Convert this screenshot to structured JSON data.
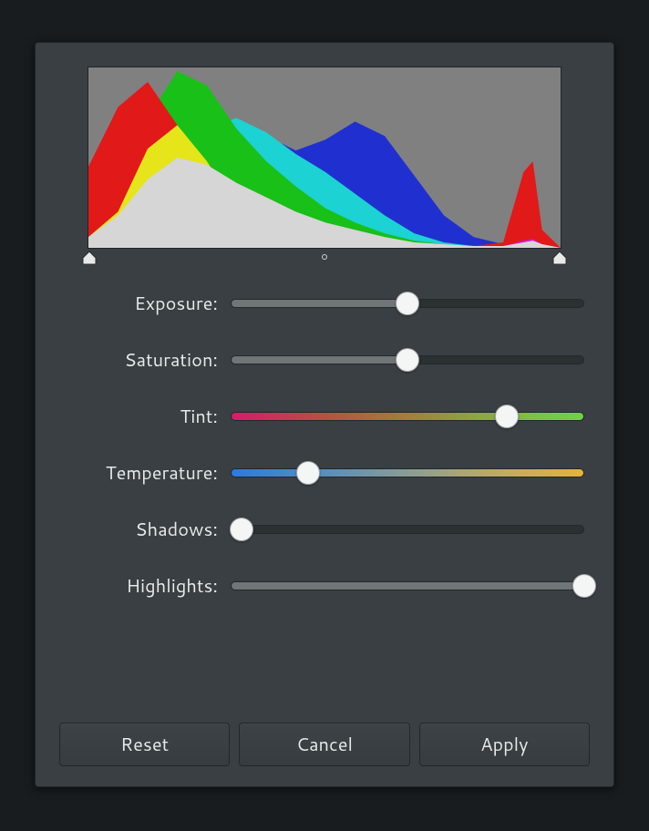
{
  "histogram": {
    "handles": {
      "left": 0,
      "mid": 50,
      "right": 100
    }
  },
  "sliders": [
    {
      "key": "exposure",
      "label": "Exposure:",
      "type": "plain",
      "value": 50
    },
    {
      "key": "saturation",
      "label": "Saturation:",
      "type": "plain",
      "value": 50
    },
    {
      "key": "tint",
      "label": "Tint:",
      "type": "tint",
      "value": 78
    },
    {
      "key": "temperature",
      "label": "Temperature:",
      "type": "temp",
      "value": 22
    },
    {
      "key": "shadows",
      "label": "Shadows:",
      "type": "plain",
      "value": 3
    },
    {
      "key": "highlights",
      "label": "Highlights:",
      "type": "plain",
      "value": 100
    }
  ],
  "buttons": {
    "reset": "Reset",
    "cancel": "Cancel",
    "apply": "Apply"
  },
  "chart_data": {
    "type": "area",
    "title": "",
    "xlabel": "",
    "ylabel": "",
    "xlim": [
      0,
      255
    ],
    "ylim": [
      0,
      100
    ],
    "x": [
      0,
      16,
      32,
      48,
      64,
      80,
      96,
      112,
      128,
      144,
      160,
      176,
      192,
      208,
      224,
      235,
      240,
      245,
      255
    ],
    "series": [
      {
        "name": "red",
        "color": "#e11919",
        "values": [
          45,
          78,
          92,
          68,
          30,
          14,
          8,
          5,
          4,
          3,
          2,
          2,
          1,
          1,
          3,
          42,
          48,
          10,
          0
        ]
      },
      {
        "name": "green",
        "color": "#18c018",
        "values": [
          8,
          28,
          72,
          98,
          90,
          66,
          48,
          34,
          22,
          14,
          8,
          4,
          2,
          1,
          0,
          0,
          0,
          0,
          0
        ]
      },
      {
        "name": "blue",
        "color": "#2030d0",
        "values": [
          4,
          10,
          22,
          38,
          56,
          70,
          62,
          54,
          60,
          70,
          62,
          40,
          18,
          6,
          2,
          1,
          1,
          1,
          0
        ]
      },
      {
        "name": "yellow",
        "color": "#e5e51a",
        "values": [
          6,
          20,
          55,
          68,
          48,
          22,
          10,
          4,
          2,
          1,
          0,
          0,
          0,
          0,
          0,
          0,
          0,
          0,
          0
        ]
      },
      {
        "name": "cyan",
        "color": "#1cd2d2",
        "values": [
          2,
          8,
          24,
          46,
          66,
          72,
          64,
          52,
          42,
          30,
          18,
          8,
          3,
          1,
          0,
          0,
          0,
          0,
          0
        ]
      },
      {
        "name": "magenta",
        "color": "#d21cd2",
        "values": [
          1,
          3,
          6,
          8,
          9,
          8,
          6,
          5,
          4,
          3,
          2,
          2,
          1,
          1,
          1,
          4,
          5,
          2,
          0
        ]
      },
      {
        "name": "luma",
        "color": "#d6d6d6",
        "values": [
          6,
          18,
          38,
          50,
          46,
          36,
          28,
          20,
          14,
          10,
          6,
          3,
          2,
          1,
          1,
          3,
          4,
          2,
          0
        ]
      }
    ]
  }
}
